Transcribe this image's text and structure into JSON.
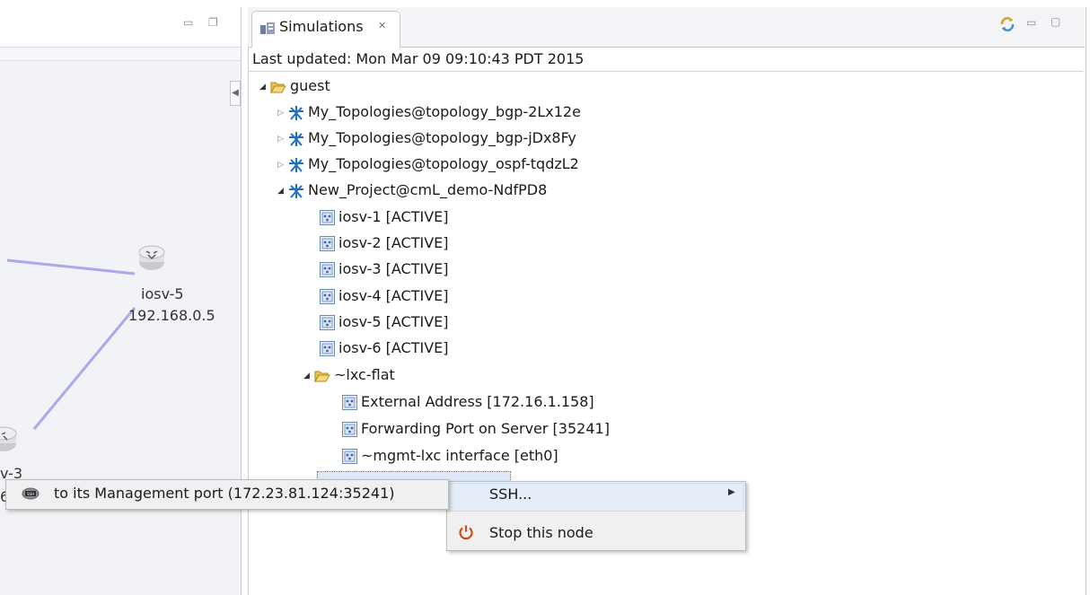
{
  "left_view": {
    "nodes": [
      {
        "name": "iosv-5",
        "ip": "192.168.0.5"
      },
      {
        "name": "v-3",
        "ip": "6"
      }
    ]
  },
  "simulations_view": {
    "tab_title": "Simulations",
    "last_updated": "Last updated: Mon Mar 09 09:10:43 PDT 2015",
    "tree": {
      "root": "guest",
      "topologies": [
        "My_Topologies@topology_bgp-2Lx12e",
        "My_Topologies@topology_bgp-jDx8Fy",
        "My_Topologies@topology_ospf-tqdzL2",
        "New_Project@cmL_demo-NdfPD8"
      ],
      "nodes": [
        "iosv-1  [ACTIVE]",
        "iosv-2  [ACTIVE]",
        "iosv-3  [ACTIVE]",
        "iosv-4  [ACTIVE]",
        "iosv-5  [ACTIVE]",
        "iosv-6  [ACTIVE]"
      ],
      "lxc_folder": "~lxc-flat",
      "lxc_items": [
        "External Address  [172.16.1.158]",
        "Forwarding Port on Server  [35241]",
        "~mgmt-lxc interface  [eth0]"
      ]
    }
  },
  "context_menu": {
    "ssh_label": "SSH...",
    "stop_label": "Stop this node",
    "submenu_label": "to its Management port (172.23.81.124:35241)"
  },
  "colors": {
    "link_line": "#a9a9ec",
    "menu_highlight": "#e5eef8",
    "stop_icon": "#d4481b"
  }
}
